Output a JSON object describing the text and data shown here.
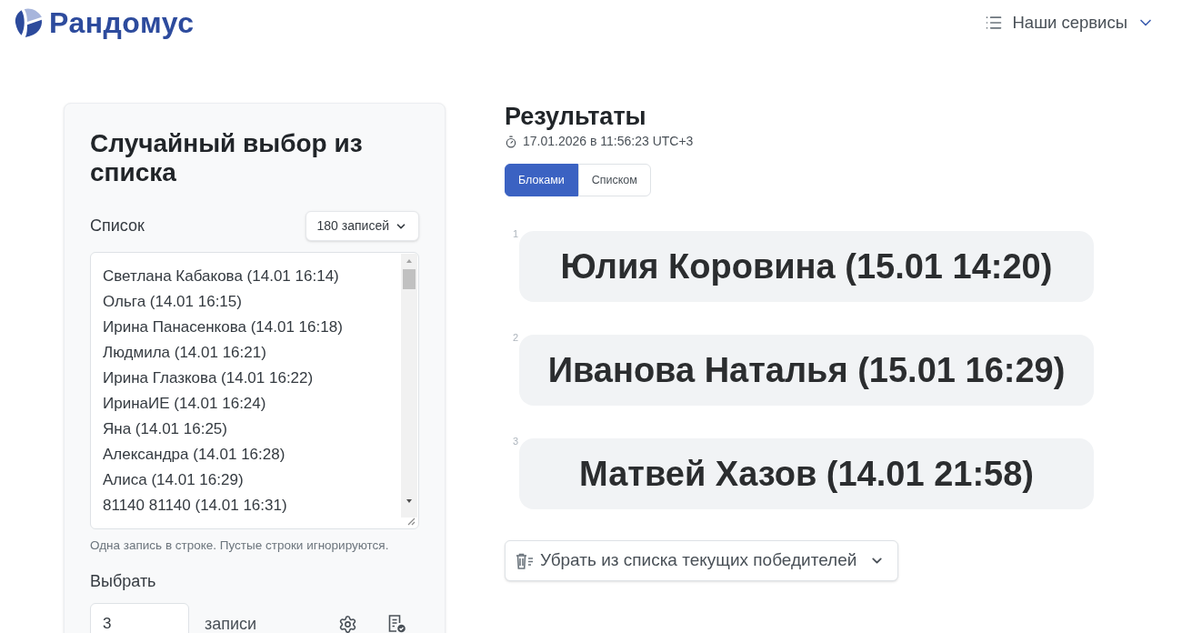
{
  "header": {
    "logo_text": "Рандомус",
    "services_menu": {
      "label": "Наши сервисы"
    }
  },
  "generator": {
    "title": "Случайный выбор из списка",
    "list_label": "Список",
    "count_select": "180 записей",
    "entries": [
      "Светлана Кабакова (14.01 16:14)",
      "Ольга (14.01 16:15)",
      "Ирина Панасенкова (14.01 16:18)",
      "Людмила (14.01 16:21)",
      "Ирина Глазкова (14.01 16:22)",
      "ИринаИЕ (14.01 16:24)",
      "Яна (14.01 16:25)",
      "Александра (14.01 16:28)",
      "Алиса (14.01 16:29)",
      "81140 81140 (14.01 16:31)"
    ],
    "hint": "Одна запись в строке. Пустые строки игнорируются.",
    "pick_label": "Выбрать",
    "pick_count": "3",
    "pick_unit": "записи"
  },
  "results": {
    "title": "Результаты",
    "timestamp": "17.01.2026 в 11:56:23 UTC+3",
    "view_tabs": [
      {
        "label": "Блоками",
        "selected": true
      },
      {
        "label": "Списком",
        "selected": false
      }
    ],
    "winners": [
      {
        "number": "1",
        "name": "Юлия Коровина (15.01 14:20)"
      },
      {
        "number": "2",
        "name": "Иванова Наталья (15.01 16:29)"
      },
      {
        "number": "3",
        "name": "Матвей Хазов (14.01 21:58)"
      }
    ],
    "remove_button": "Убрать из списка текущих победителей"
  }
}
